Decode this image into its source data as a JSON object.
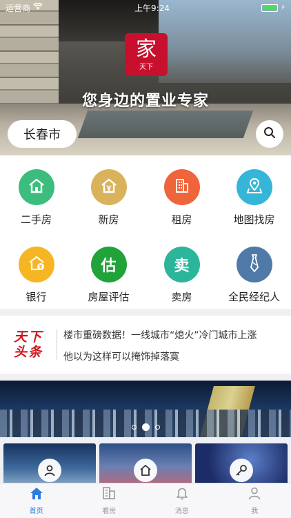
{
  "status_bar": {
    "carrier": "运营商",
    "time": "上午9:24"
  },
  "hero": {
    "logo_main": "家",
    "logo_sub": "天下",
    "slogan": "您身边的置业专家"
  },
  "city_selector": {
    "label": "长春市"
  },
  "grid": [
    {
      "label": "二手房",
      "color": "#3dbd7d",
      "icon": "house-icon"
    },
    {
      "label": "新房",
      "color": "#d9b25c",
      "icon": "house-yen-icon"
    },
    {
      "label": "租房",
      "color": "#f0643c",
      "icon": "building-icon"
    },
    {
      "label": "地图找房",
      "color": "#35b6d8",
      "icon": "map-pin-icon"
    },
    {
      "label": "银行",
      "color": "#f6b623",
      "icon": "bank-icon",
      "glyph": ""
    },
    {
      "label": "房屋评估",
      "color": "#22a33a",
      "icon": "appraise-icon",
      "glyph": "估"
    },
    {
      "label": "卖房",
      "color": "#2bb59a",
      "icon": "sell-icon",
      "glyph": "卖"
    },
    {
      "label": "全民经纪人",
      "color": "#4f7aa8",
      "icon": "tie-icon"
    }
  ],
  "news": {
    "logo_line1": "天下",
    "logo_line2": "头条",
    "headline1": "楼市重磅数据！一线城市“熄火”冷门城市上涨",
    "headline2": "他以为这样可以掩饰掉落寞"
  },
  "tabbar": [
    {
      "label": "首页",
      "icon": "home-icon",
      "active": true
    },
    {
      "label": "看房",
      "icon": "building-list-icon",
      "active": false
    },
    {
      "label": "消息",
      "icon": "bell-icon",
      "active": false
    },
    {
      "label": "我",
      "icon": "person-icon",
      "active": false
    }
  ],
  "colors": {
    "accent": "#2b7de1",
    "news_red": "#d4161b"
  }
}
